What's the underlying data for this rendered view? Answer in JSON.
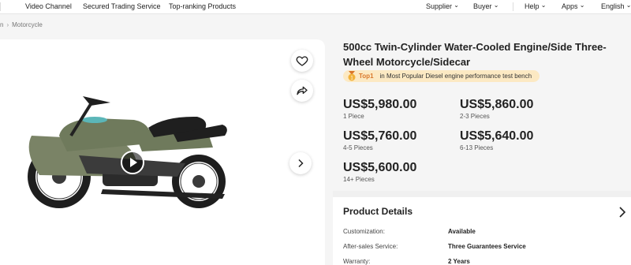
{
  "top_nav": {
    "left_items": [
      "Video Channel",
      "Secured Trading Service",
      "Top-ranking Products"
    ],
    "right_items": {
      "supplier": "Supplier",
      "buyer": "Buyer",
      "help": "Help",
      "apps": "Apps",
      "language": "English"
    }
  },
  "breadcrumb": {
    "parent": "n",
    "current": "Motorcycle"
  },
  "gallery": {
    "icons": [
      "heart-icon",
      "share-icon",
      "chevron-right-icon",
      "play-icon"
    ]
  },
  "product": {
    "title": "500cc Twin-Cylinder Water-Cooled Engine/Side Three-Wheel Motorcycle/Sidecar",
    "rank_badge": {
      "label": "Top1",
      "text": "in Most Popular Diesel engine performance test bench"
    },
    "prices": [
      {
        "price": "US$5,980.00",
        "qty": "1 Piece"
      },
      {
        "price": "US$5,860.00",
        "qty": "2-3 Pieces"
      },
      {
        "price": "US$5,760.00",
        "qty": "4-5 Pieces"
      },
      {
        "price": "US$5,640.00",
        "qty": "6-13 Pieces"
      },
      {
        "price": "US$5,600.00",
        "qty": "14+ Pieces"
      }
    ]
  },
  "details": {
    "heading": "Product Details",
    "rows": [
      {
        "key": "Customization:",
        "value": "Available"
      },
      {
        "key": "After-sales Service:",
        "value": "Three Guarantees Service"
      },
      {
        "key": "Warranty:",
        "value": "2 Years"
      }
    ]
  },
  "colors": {
    "badge_bg": "#fce9c3",
    "badge_accent": "#d9772b",
    "bike_body": "#6f7a5c"
  }
}
